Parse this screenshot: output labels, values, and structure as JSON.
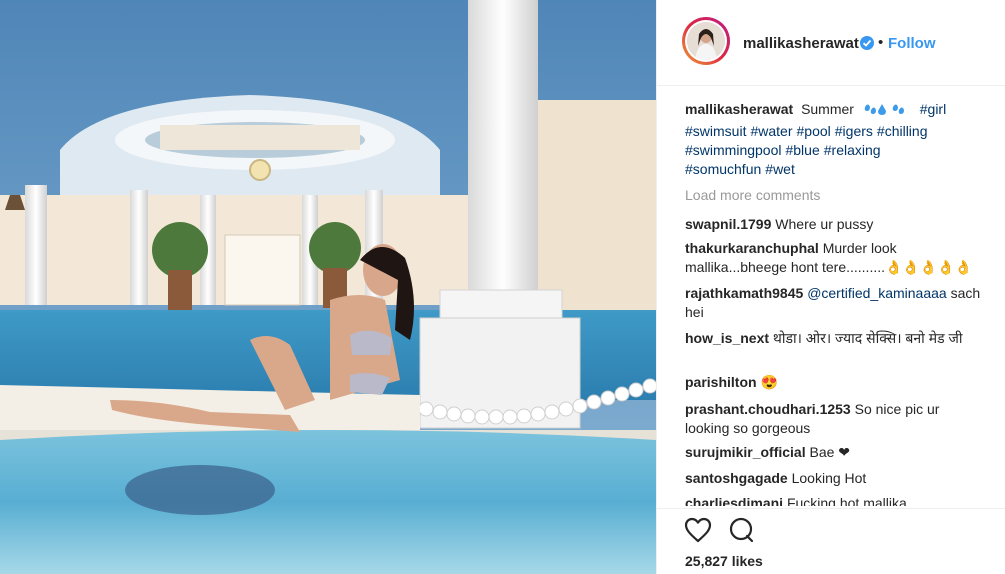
{
  "post": {
    "username": "mallikasherawat",
    "separator": "•",
    "follow_label": "Follow",
    "caption_text": "Summer",
    "hashtags": [
      "#girl",
      "#swimsuit",
      "#water",
      "#pool",
      "#igers",
      "#chilling",
      "#swimmingpool",
      "#blue",
      "#relaxing",
      "#somuchfun",
      "#wet"
    ],
    "load_more": "Load more comments",
    "likes": "25,827 likes"
  },
  "comments": [
    {
      "user": "swapnil.1799",
      "text": "Where ur pussy"
    },
    {
      "user": "thakurkaranchuphal",
      "text": "Murder look mallika...bheege hont tere..........👌👌👌👌👌"
    },
    {
      "user": "rajathkamath9845",
      "mention": "@certified_kaminaaaa",
      "text": "sach hei"
    },
    {
      "user": "how_is_next",
      "text": "थोडा। ओर। ज्याद सेक्सि। बनो मेड जी"
    },
    {
      "user": "parishilton",
      "text": "😍"
    },
    {
      "user": "prashant.choudhari.1253",
      "text": "So nice pic ur looking so gorgeous"
    },
    {
      "user": "surujmikir_official",
      "text": "Bae ❤"
    },
    {
      "user": "santoshgagade",
      "text": "Looking Hot"
    },
    {
      "user": "charliesdimani",
      "text": "Fucking hot mallika"
    }
  ],
  "icons": {
    "like": "heart-icon",
    "comment": "comment-bubble-icon",
    "verified": "verified-badge-icon"
  },
  "colors": {
    "link": "#3897f0",
    "hashtag": "#003569",
    "muted": "#999999",
    "text": "#262626"
  }
}
